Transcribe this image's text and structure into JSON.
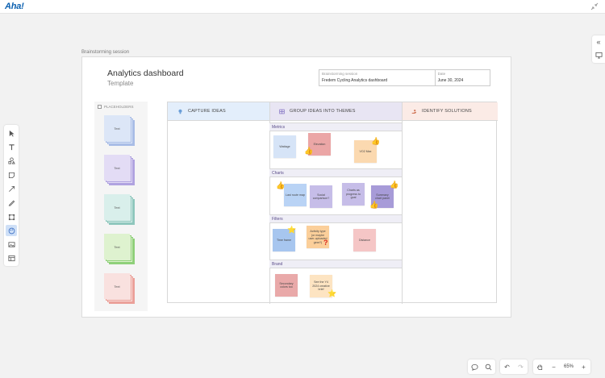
{
  "app": {
    "logo": "Aha!"
  },
  "session_label": "Brainstorming session",
  "whiteboard": {
    "title": "Analytics dashboard",
    "subtitle": "Template",
    "meta": [
      {
        "label": "Brainstorming session",
        "value": "Fredem Cycling Analytics dashboard"
      },
      {
        "label": "Date",
        "value": "June 30, 2024"
      }
    ]
  },
  "placeholders": {
    "header": "PLACEHOLDERS",
    "stacks": [
      {
        "label": "Text",
        "color": "#dce6f7",
        "edge": "#a9bde6"
      },
      {
        "label": "Text",
        "color": "#e3dcf5",
        "edge": "#b0a3e0"
      },
      {
        "label": "Text",
        "color": "#d9efeb",
        "edge": "#8fc7bd"
      },
      {
        "label": "Text",
        "color": "#def2cf",
        "edge": "#8fd07a"
      },
      {
        "label": "Text",
        "color": "#f9e1df",
        "edge": "#eba19a"
      }
    ]
  },
  "columns": [
    {
      "label": "CAPTURE IDEAS",
      "color": "#e3eefb",
      "icon": "lightbulb-icon"
    },
    {
      "label": "GROUP IDEAS INTO THEMES",
      "color": "#e8e5f3",
      "icon": "grid-icon"
    },
    {
      "label": "IDENTIFY SOLUTIONS",
      "color": "#fbebe6",
      "icon": "hand-icon"
    }
  ],
  "sections": [
    "Metrics",
    "Charts",
    "Filters",
    "Brand"
  ],
  "stickies": {
    "metrics": [
      {
        "text": "Wattage",
        "color": "#d6e4f7"
      },
      {
        "text": "Elevation",
        "color": "#eba6a6"
      },
      {
        "text": "VO2 Max",
        "color": "#fbd9b0"
      }
    ],
    "charts": [
      {
        "text": "Last route map",
        "color": "#b9d3f5"
      },
      {
        "text": "Social comparison?",
        "color": "#c6bde8"
      },
      {
        "text": "Charts as progress to goal",
        "color": "#c6bde8"
      },
      {
        "text": "Summary chart panel",
        "color": "#a79bd8"
      }
    ],
    "filters": [
      {
        "text": "Time frame",
        "color": "#a7c6ef"
      },
      {
        "text": "Activity type (or maybe user-uploaded gear?)",
        "color": "#fbcf9a"
      },
      {
        "text": "Distance",
        "color": "#f5c6c6"
      }
    ],
    "brand": [
      {
        "text": "Secondary colors too",
        "color": "#e9a9a9"
      },
      {
        "text": "See the Y4 2024 creative brief",
        "color": "#fde4c2"
      }
    ]
  },
  "bottom": {
    "zoom": "65%"
  }
}
